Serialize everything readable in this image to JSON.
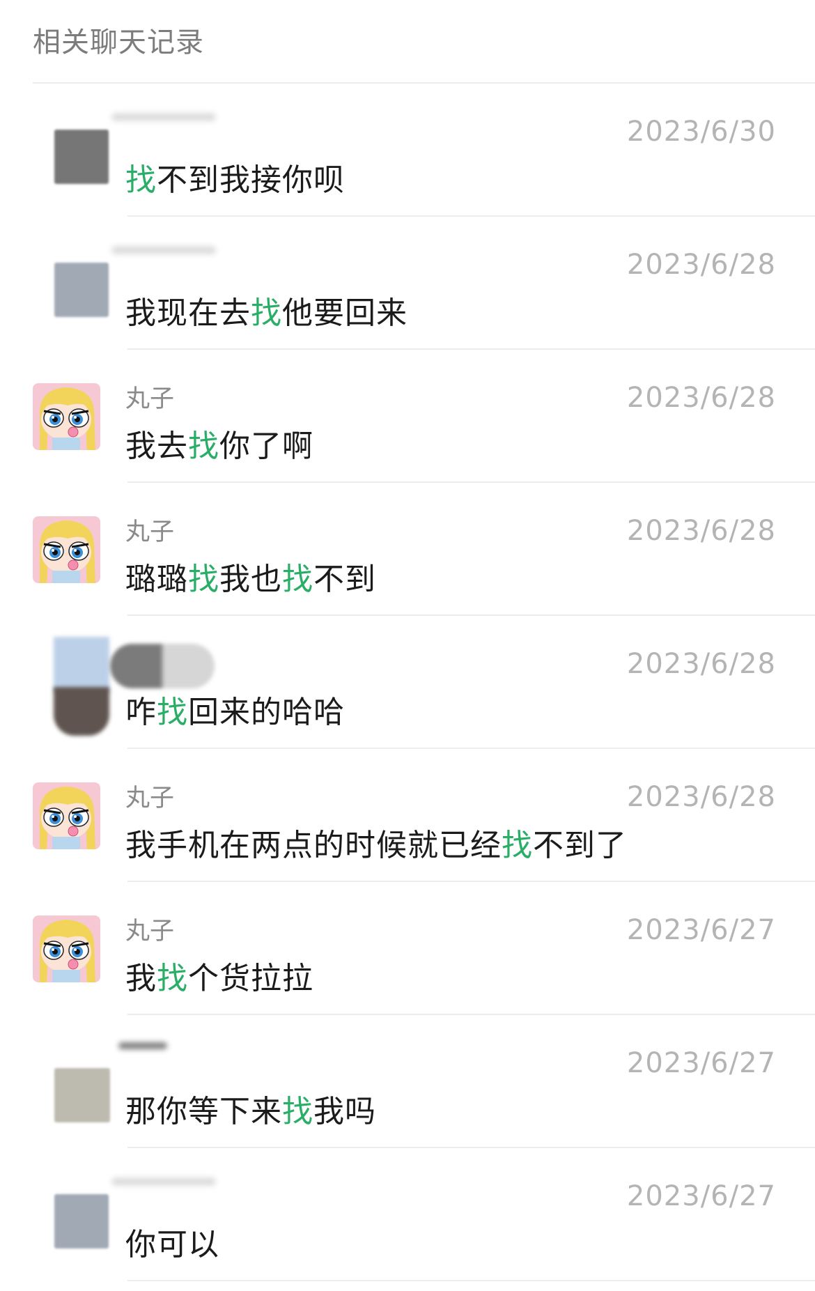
{
  "header": {
    "title": "相关聊天记录"
  },
  "highlight_color": "#2aae67",
  "messages": [
    {
      "avatar": "blurred-gray-avatar",
      "name": "",
      "date": "2023/6/30",
      "text": [
        {
          "t": "找",
          "hl": true
        },
        {
          "t": "不到我接你呗",
          "hl": false
        }
      ]
    },
    {
      "avatar": "blurred-blue-avatar",
      "name": "",
      "date": "2023/6/28",
      "text": [
        {
          "t": "我现在去",
          "hl": false
        },
        {
          "t": "找",
          "hl": true
        },
        {
          "t": "他要回来",
          "hl": false
        }
      ]
    },
    {
      "avatar": "cartoon-girl-avatar",
      "name": "丸子",
      "date": "2023/6/28",
      "text": [
        {
          "t": "我去",
          "hl": false
        },
        {
          "t": "找",
          "hl": true
        },
        {
          "t": "你了啊",
          "hl": false
        }
      ]
    },
    {
      "avatar": "cartoon-girl-avatar",
      "name": "丸子",
      "date": "2023/6/28",
      "text": [
        {
          "t": "璐璐",
          "hl": false
        },
        {
          "t": "找",
          "hl": true
        },
        {
          "t": "我也",
          "hl": false
        },
        {
          "t": "找",
          "hl": true
        },
        {
          "t": "不到",
          "hl": false
        }
      ]
    },
    {
      "avatar": "blurred-photo-avatar",
      "name": "",
      "date": "2023/6/28",
      "text": [
        {
          "t": "咋",
          "hl": false
        },
        {
          "t": "找",
          "hl": true
        },
        {
          "t": "回来的哈哈",
          "hl": false
        }
      ]
    },
    {
      "avatar": "cartoon-girl-avatar",
      "name": "丸子",
      "date": "2023/6/28",
      "text": [
        {
          "t": "我手机在两点的时候就已经",
          "hl": false
        },
        {
          "t": "找",
          "hl": true
        },
        {
          "t": "不到了",
          "hl": false
        }
      ]
    },
    {
      "avatar": "cartoon-girl-avatar",
      "name": "丸子",
      "date": "2023/6/27",
      "text": [
        {
          "t": "我",
          "hl": false
        },
        {
          "t": "找",
          "hl": true
        },
        {
          "t": "个货拉拉",
          "hl": false
        }
      ]
    },
    {
      "avatar": "blurred-beige-avatar",
      "name": "",
      "date": "2023/6/27",
      "text": [
        {
          "t": "那你等下来",
          "hl": false
        },
        {
          "t": "找",
          "hl": true
        },
        {
          "t": "我吗",
          "hl": false
        }
      ]
    },
    {
      "avatar": "blurred-blue-avatar",
      "name": "",
      "date": "2023/6/27",
      "text": [
        {
          "t": "你可以",
          "hl": false
        }
      ]
    }
  ]
}
